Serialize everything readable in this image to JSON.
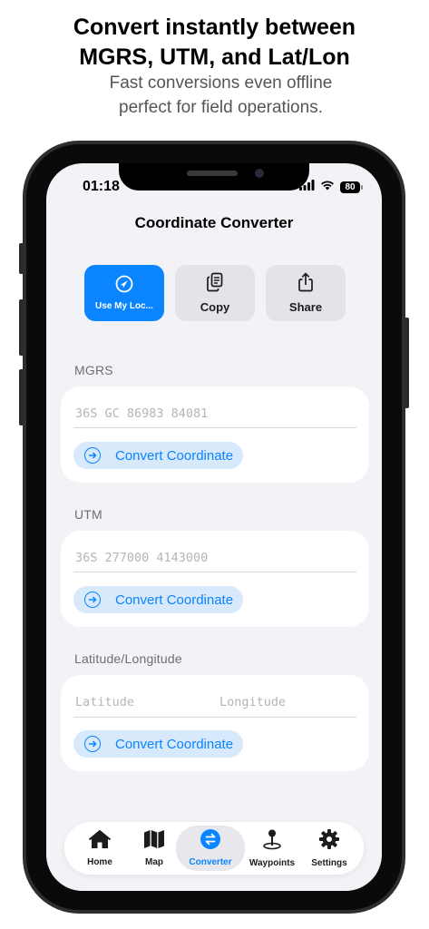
{
  "promo": {
    "headline_line1": "Convert instantly between",
    "headline_line2": "MGRS, UTM, and Lat/Lon",
    "subline1": "Fast conversions even offline",
    "subline2": "perfect for field operations."
  },
  "status_bar": {
    "time": "01:18",
    "battery": "80"
  },
  "nav": {
    "title": "Coordinate Converter"
  },
  "actions": [
    {
      "label": "Use My Loc...",
      "icon": "location-arrow-icon"
    },
    {
      "label": "Copy",
      "icon": "copy-icon"
    },
    {
      "label": "Share",
      "icon": "share-icon"
    }
  ],
  "mgrs": {
    "label": "MGRS",
    "placeholder": "36S GC 86983 84081",
    "value": "",
    "button": "Convert Coordinate"
  },
  "utm": {
    "label": "UTM",
    "placeholder": "36S 277000 4143000",
    "value": "",
    "button": "Convert Coordinate"
  },
  "latlon": {
    "label": "Latitude/Longitude",
    "lat_placeholder": "Latitude",
    "lon_placeholder": "Longitude",
    "button": "Convert Coordinate"
  },
  "tabs": [
    {
      "label": "Home",
      "icon": "home-icon",
      "active": false
    },
    {
      "label": "Map",
      "icon": "map-icon",
      "active": false
    },
    {
      "label": "Converter",
      "icon": "converter-icon",
      "active": true
    },
    {
      "label": "Waypoints",
      "icon": "waypoint-pin-icon",
      "active": false
    },
    {
      "label": "Settings",
      "icon": "gear-icon",
      "active": false
    }
  ],
  "colors": {
    "accent": "#0a84ff",
    "background": "#f2f2f7",
    "card": "#ffffff",
    "convert_button_bg": "#d8e9fb"
  }
}
